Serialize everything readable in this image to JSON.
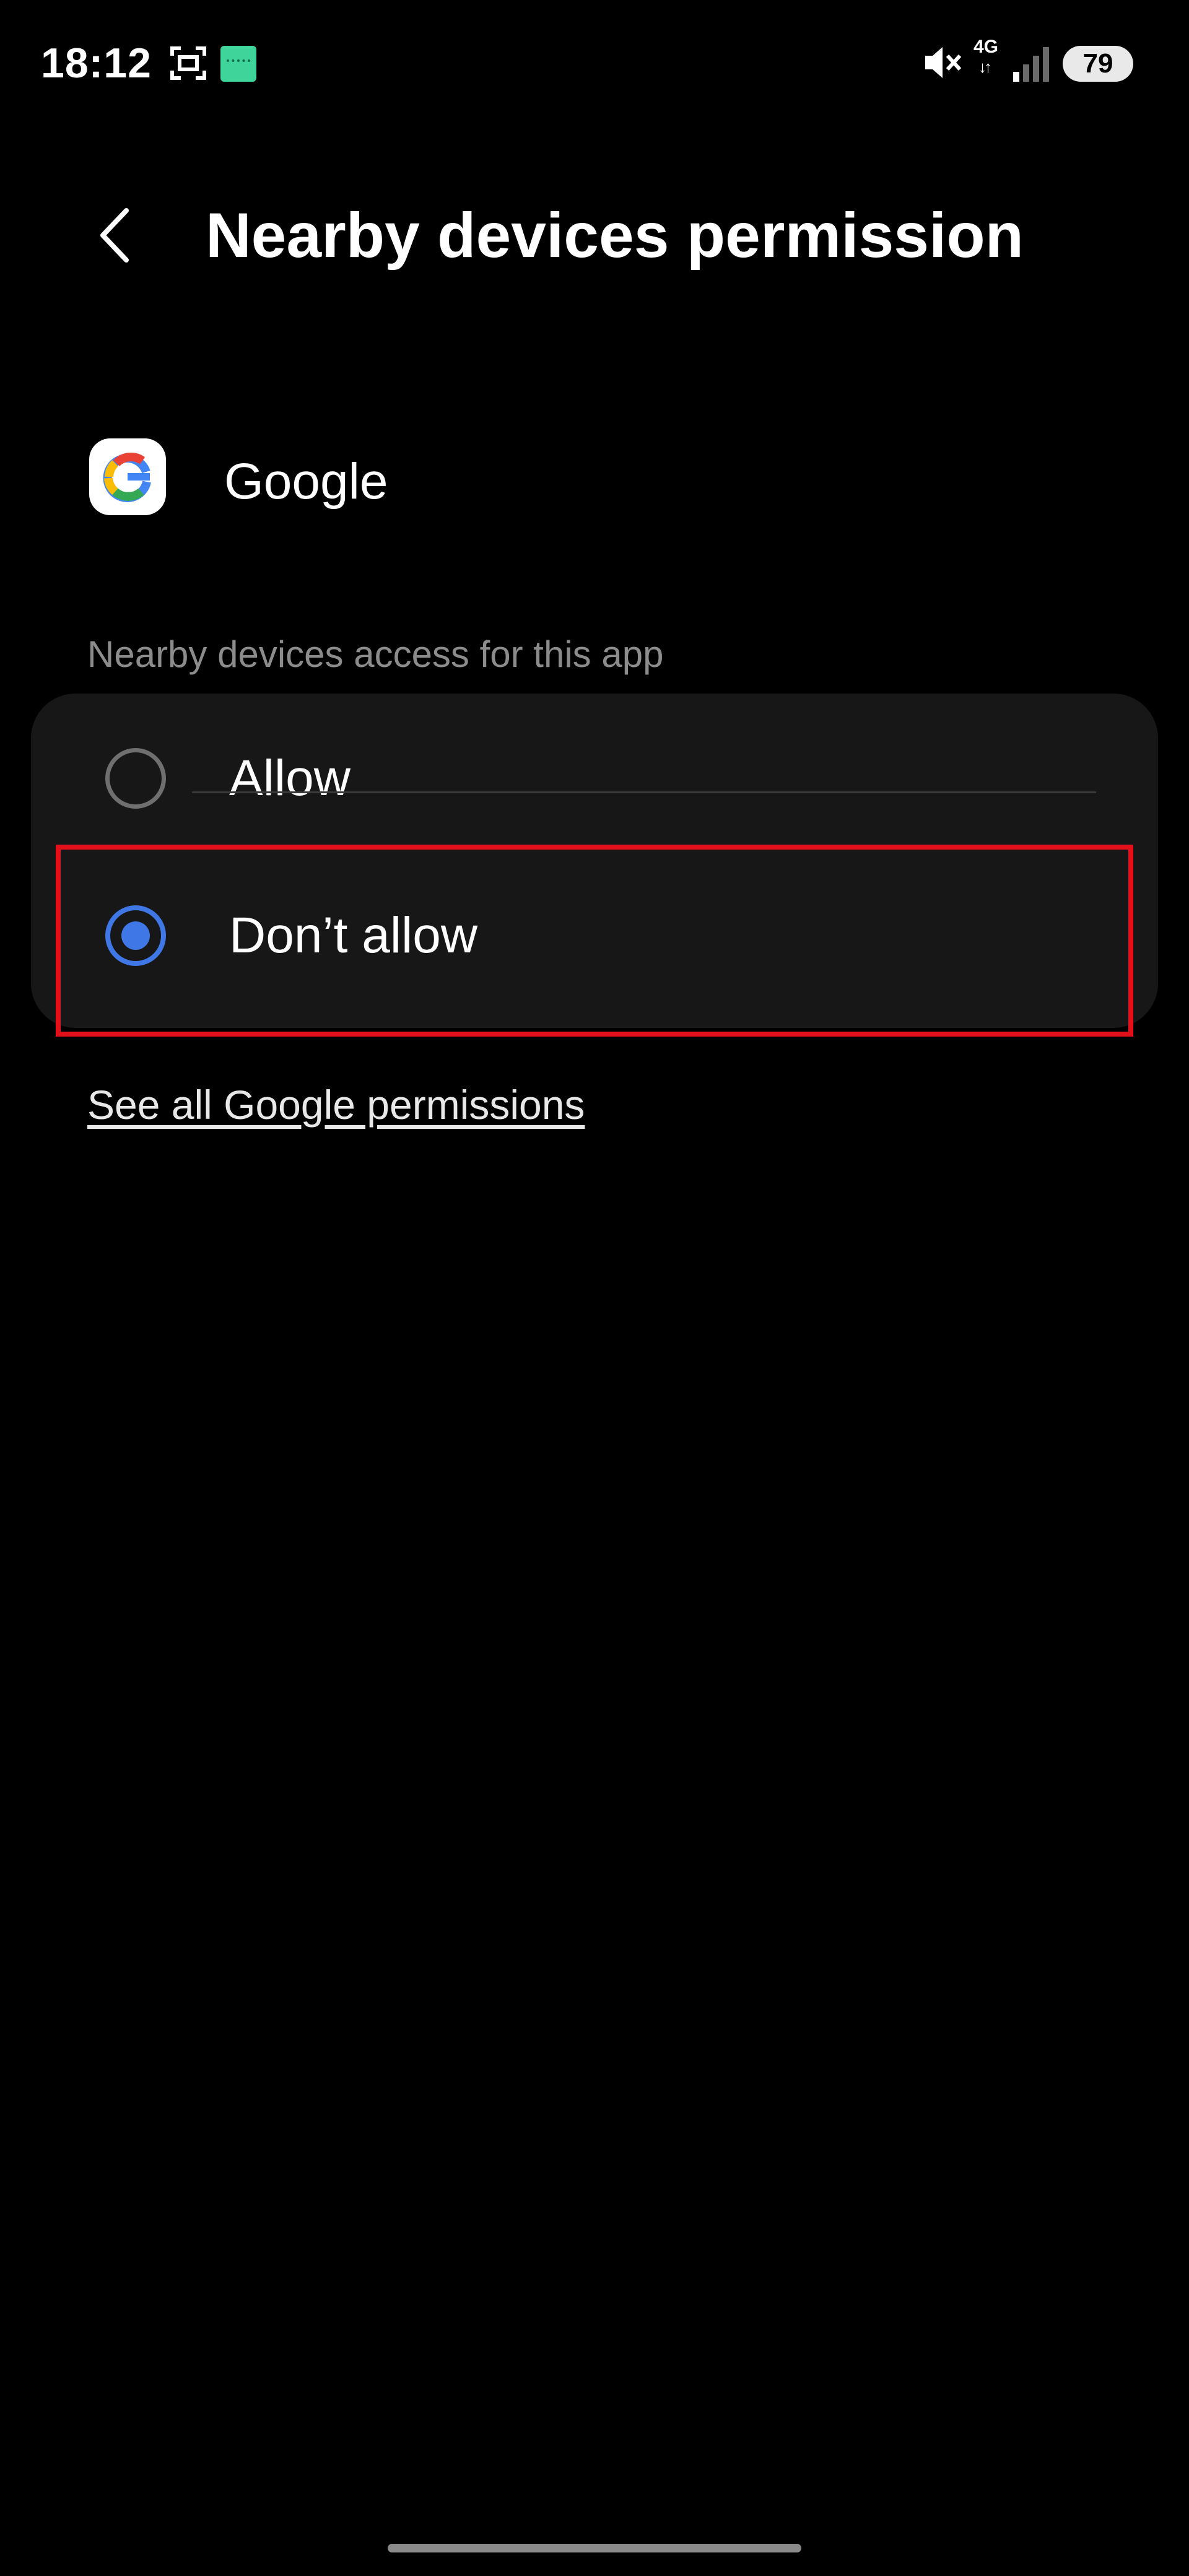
{
  "status_bar": {
    "time": "18:12",
    "network_label": "4G",
    "network_arrows": "↓↑",
    "battery": "79",
    "icons": [
      "screen-recorder-icon",
      "app-notification-icon",
      "mute-icon",
      "network-4g-icon",
      "signal-strength-icon",
      "battery-icon"
    ]
  },
  "header": {
    "back_icon": "chevron-left-icon",
    "title": "Nearby devices permission"
  },
  "app": {
    "icon": "google-logo-icon",
    "name": "Google"
  },
  "section": {
    "label": "Nearby devices access for this app"
  },
  "options": [
    {
      "label": "Allow",
      "selected": false
    },
    {
      "label": "Don’t allow",
      "selected": true
    }
  ],
  "link": {
    "label": "See all Google permissions"
  },
  "colors": {
    "background": "#000000",
    "card": "#171717",
    "accent": "#3f78e6",
    "highlight": "#e3101c",
    "secondary_text": "#8c8c8c"
  }
}
